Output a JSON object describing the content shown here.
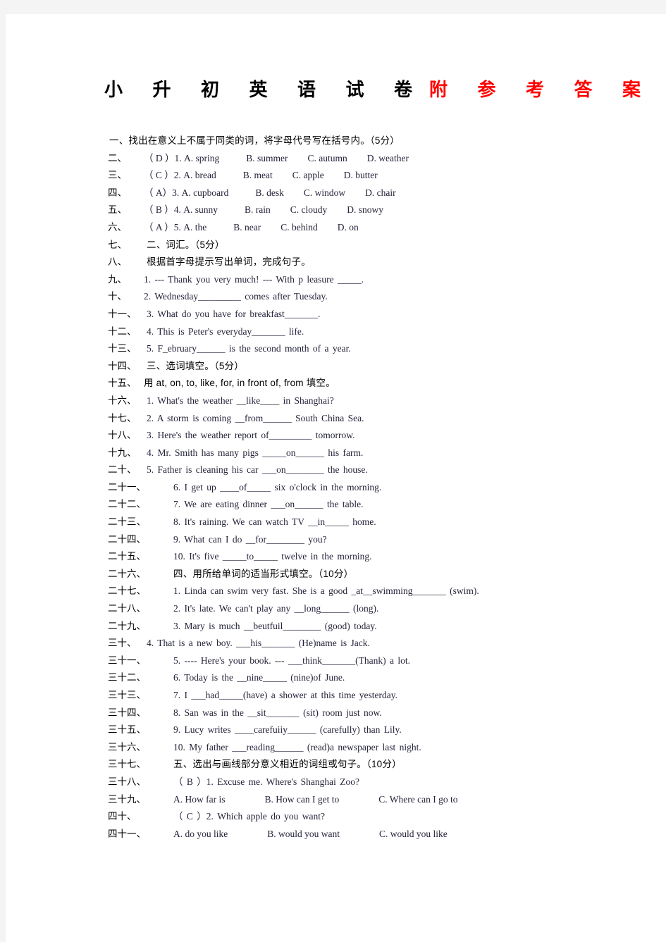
{
  "document": {
    "title_black": "小 升 初 英 语 试 卷",
    "title_red": "附 参 考 答 案",
    "title_black_color": "#000000",
    "title_red_color": "#ff0000"
  },
  "lines": [
    {
      "marker": "",
      "type": "zh",
      "indent": "head",
      "text": "一、找出在意义上不属于同类的词，将字母代号写在括号内。（5分）"
    },
    {
      "marker": "二、",
      "type": "opts",
      "indent": "main",
      "text": "（ D ）1. A. spring",
      "options": [
        "B. summer",
        "C. autumn",
        "D. weather"
      ]
    },
    {
      "marker": "三、",
      "type": "opts",
      "indent": "main",
      "text": "（ C ）2. A. bread",
      "options": [
        "B. meat",
        "C. apple",
        "D. butter"
      ]
    },
    {
      "marker": "四、",
      "type": "opts",
      "indent": "main",
      "text": "（ A）3. A. cupboard",
      "options": [
        "B. desk",
        "C. window",
        "D. chair"
      ]
    },
    {
      "marker": "五、",
      "type": "opts",
      "indent": "main",
      "text": "（ B ）4. A. sunny",
      "options": [
        "B. rain",
        "C. cloudy",
        "D. snowy"
      ]
    },
    {
      "marker": "六、",
      "type": "opts",
      "indent": "main",
      "text": "（ A ）5. A. the",
      "options": [
        "B. near",
        "C. behind",
        "D. on"
      ]
    },
    {
      "marker": "七、",
      "type": "zh",
      "indent": "sub",
      "text": "二、词汇。（5分）"
    },
    {
      "marker": "八、",
      "type": "zh",
      "indent": "sub",
      "text": "根据首字母提示写出单词，完成句子。"
    },
    {
      "marker": "九、",
      "type": "en",
      "indent": "main",
      "text": "1. --- Thank you very much! --- With p leasure _____."
    },
    {
      "marker": "十、",
      "type": "en",
      "indent": "main",
      "text": "2. Wednesday_________ comes after Tuesday."
    },
    {
      "marker": "十一、",
      "type": "en",
      "indent": "sub",
      "text": "3. What do you have for breakfast_______."
    },
    {
      "marker": "十二、",
      "type": "en",
      "indent": "sub",
      "text": "4. This is Peter's everyday_______ life."
    },
    {
      "marker": "十三、",
      "type": "en",
      "indent": "sub",
      "text": "5. F_ebruary______ is the second month of a year."
    },
    {
      "marker": "十四、",
      "type": "zh",
      "indent": "sub",
      "text": "三、选词填空。（5分）"
    },
    {
      "marker": "十五、",
      "type": "zh",
      "indent": "main",
      "text": "用 at, on, to, like, for, in front of, from 填空。"
    },
    {
      "marker": "十六、",
      "type": "en",
      "indent": "sub",
      "text": "1. What's the weather __like____ in Shanghai?"
    },
    {
      "marker": "十七、",
      "type": "en",
      "indent": "sub",
      "text": "2. A storm is coming __from______ South China Sea."
    },
    {
      "marker": "十八、",
      "type": "en",
      "indent": "sub",
      "text": "3. Here's the weather report  of_________ tomorrow."
    },
    {
      "marker": "十九、",
      "type": "en",
      "indent": "sub",
      "text": "4. Mr. Smith has many pigs _____on______ his farm."
    },
    {
      "marker": "二十、",
      "type": "en",
      "indent": "sub",
      "text": "5. Father is cleaning his car ___on________ the house."
    },
    {
      "marker": "二十一、",
      "type": "en",
      "indent": "opt",
      "text": "6. I get up ____of_____ six o'clock in the morning."
    },
    {
      "marker": "二十二、",
      "type": "en",
      "indent": "opt",
      "text": "7. We are eating dinner ___on______ the table."
    },
    {
      "marker": "二十三、",
      "type": "en",
      "indent": "opt",
      "text": "8. It's raining. We can watch TV __in_____ home."
    },
    {
      "marker": "二十四、",
      "type": "en",
      "indent": "opt",
      "text": "9. What can I do __for________ you?"
    },
    {
      "marker": "二十五、",
      "type": "en",
      "indent": "opt",
      "text": "10. It's five _____to_____ twelve in the morning."
    },
    {
      "marker": "二十六、",
      "type": "zh",
      "indent": "opt",
      "text": "四、用所给单词的适当形式填空。（10分）"
    },
    {
      "marker": "二十七、",
      "type": "en",
      "indent": "opt",
      "text": "1. Linda can swim very fast. She is a good _at__swimming_______ (swim)."
    },
    {
      "marker": "二十八、",
      "type": "en",
      "indent": "opt",
      "text": "2. It's late. We can't play any __long______ (long)."
    },
    {
      "marker": "二十九、",
      "type": "en",
      "indent": "opt",
      "text": "3. Mary is much __beutfuil________ (good) today."
    },
    {
      "marker": "三十、",
      "type": "en",
      "indent": "sub",
      "text": "4. That is a new boy. ___his_______ (He)name is Jack."
    },
    {
      "marker": "三十一、",
      "type": "en",
      "indent": "opt",
      "text": "5. ---- Here's your book. --- ___think_______(Thank) a lot."
    },
    {
      "marker": "三十二、",
      "type": "en",
      "indent": "opt",
      "text": "6. Today is the __nine_____ (nine)of June."
    },
    {
      "marker": "三十三、",
      "type": "en",
      "indent": "opt",
      "text": "7. I ___had_____(have) a shower at this time yesterday."
    },
    {
      "marker": "三十四、",
      "type": "en",
      "indent": "opt",
      "text": "8. San was in the __sit_______ (sit) room just now."
    },
    {
      "marker": "三十五、",
      "type": "en",
      "indent": "opt",
      "text": "9. Lucy writes ____carefuiiy______ (carefully) than Lily."
    },
    {
      "marker": "三十六、",
      "type": "en",
      "indent": "opt",
      "text": "10. My father ___reading______ (read)a newspaper last night."
    },
    {
      "marker": "三十七、",
      "type": "zh",
      "indent": "opt",
      "text": "五、选出与画线部分意义相近的词组或句子。（10分）"
    },
    {
      "marker": "三十八、",
      "type": "en",
      "indent": "opt",
      "text": "（ B ）1. Excuse me. Where's Shanghai Zoo?"
    },
    {
      "marker": "三十九、",
      "type": "abc",
      "indent": "opt",
      "text": "A. How far is",
      "options": [
        "B. How can I get to",
        "C. Where can I go to"
      ]
    },
    {
      "marker": "四十、",
      "type": "en",
      "indent": "opt",
      "text": "（ C ）2. Which apple do you want?"
    },
    {
      "marker": "四十一、",
      "type": "abc",
      "indent": "opt",
      "text": "A. do you like",
      "options": [
        "B. would you want",
        "C. would you like"
      ]
    }
  ]
}
